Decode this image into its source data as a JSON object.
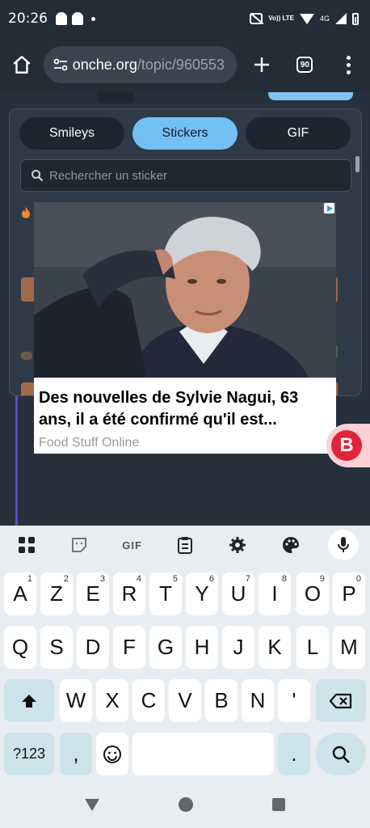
{
  "status": {
    "time": "20:26",
    "network_label": "4G",
    "volte_label": "Vo)) LTE"
  },
  "browser": {
    "url_host": "onche.org",
    "url_path": "/topic/960553",
    "tab_count": "90"
  },
  "picker": {
    "tabs": [
      {
        "label": "Smileys",
        "active": false
      },
      {
        "label": "Stickers",
        "active": true
      },
      {
        "label": "GIF",
        "active": false
      }
    ],
    "search_placeholder": "Rechercher un sticker"
  },
  "ad": {
    "title": "Des nouvelles de Sylvie Nagui, 63 ans, il a été confirmé qu'il est...",
    "source": "Food Stuff Online",
    "badge_letter": "B"
  },
  "keyboard": {
    "toolbar": {
      "gif_label": "GIF"
    },
    "row1": [
      {
        "key": "A",
        "hint": "1"
      },
      {
        "key": "Z",
        "hint": "2"
      },
      {
        "key": "E",
        "hint": "3"
      },
      {
        "key": "R",
        "hint": "4"
      },
      {
        "key": "T",
        "hint": "5"
      },
      {
        "key": "Y",
        "hint": "6"
      },
      {
        "key": "U",
        "hint": "7"
      },
      {
        "key": "I",
        "hint": "8"
      },
      {
        "key": "O",
        "hint": "9"
      },
      {
        "key": "P",
        "hint": "0"
      }
    ],
    "row2": [
      "Q",
      "S",
      "D",
      "F",
      "G",
      "H",
      "J",
      "K",
      "L",
      "M"
    ],
    "row3": [
      "W",
      "X",
      "C",
      "V",
      "B",
      "N",
      "'"
    ],
    "row4": {
      "symbols_label": "?123",
      "comma": ",",
      "period": "."
    }
  },
  "colors": {
    "accent": "#74c0f4",
    "page_bg": "#26313d",
    "keyboard_bg": "#e8edf2",
    "brand_badge": "#e0243b"
  }
}
